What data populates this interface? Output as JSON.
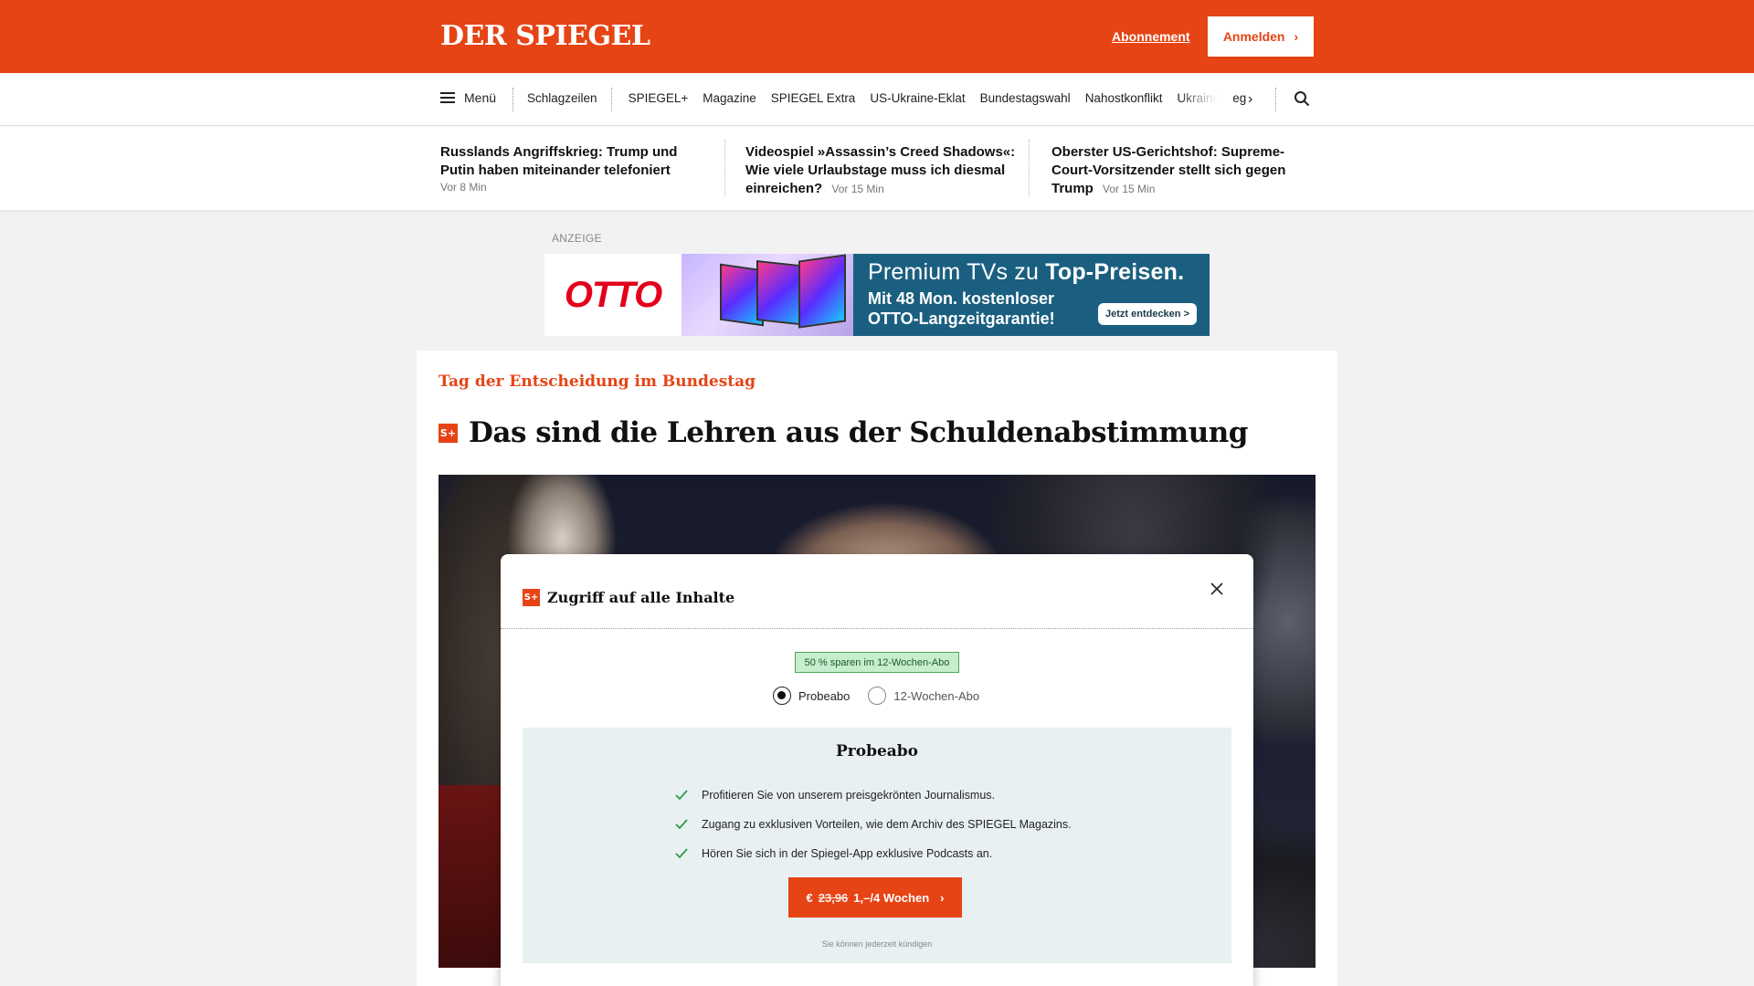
{
  "header": {
    "logo": "DER SPIEGEL",
    "abo_link": "Abonnement",
    "login_label": "Anmelden",
    "brand_color": "#e64415"
  },
  "nav": {
    "menu_label": "Menü",
    "items": [
      "Schlagzeilen",
      "SPIEGEL+",
      "Magazine",
      "SPIEGEL Extra",
      "US-Ukraine-Eklat",
      "Bundestagswahl",
      "Nahostkonflikt",
      "Ukrainekrieg"
    ],
    "more_icon": "chevron-right-icon",
    "search_icon": "search-icon"
  },
  "ticker": [
    {
      "title": "Russlands Angriffskrieg: Trump und Putin haben miteinander telefoniert",
      "time": "Vor 8 Min"
    },
    {
      "title": "Videospiel »Assassin’s Creed Shadows«: Wie viele Urlaubstage muss ich diesmal einreichen?",
      "time": "Vor 15 Min"
    },
    {
      "title": "Oberster US-Gerichtshof: Supreme-Court-Vorsitzender stellt sich gegen Trump",
      "time": "Vor 15 Min"
    }
  ],
  "ad": {
    "label": "ANZEIGE",
    "brand": "OTTO",
    "headline_prefix": "Premium TVs zu ",
    "headline_bold": "Top-Preisen.",
    "subline": "Mit 48 Mon. kostenloser OTTO-Langzeitgarantie!",
    "cta": "Jetzt entdecken >"
  },
  "article": {
    "kicker": "Tag der Entscheidung im Bundestag",
    "badge": "S+",
    "title": "Das sind die Lehren aus der Schuldenabstimmung"
  },
  "modal": {
    "title": "Zugriff auf alle Inhalte",
    "badge": "S+",
    "save_badge": "50 % sparen im 12-Wochen-Abo",
    "options": [
      {
        "label": "Probeabo",
        "selected": true
      },
      {
        "label": "12-Wochen-Abo",
        "selected": false
      }
    ],
    "offer": {
      "title": "Probeabo",
      "benefits": [
        "Profitieren Sie von unserem preisgekrönten Journalismus.",
        "Zugang zu exklusiven Vorteilen, wie dem Archiv des SPIEGEL Magazins.",
        "Hören Sie sich in der Spiegel-App exklusive Podcasts an."
      ],
      "cta_currency": "€",
      "cta_old_price": "23,96",
      "cta_new_price": "1,–/4 Wochen",
      "cancel_note": "Sie können jederzeit kündigen"
    }
  }
}
